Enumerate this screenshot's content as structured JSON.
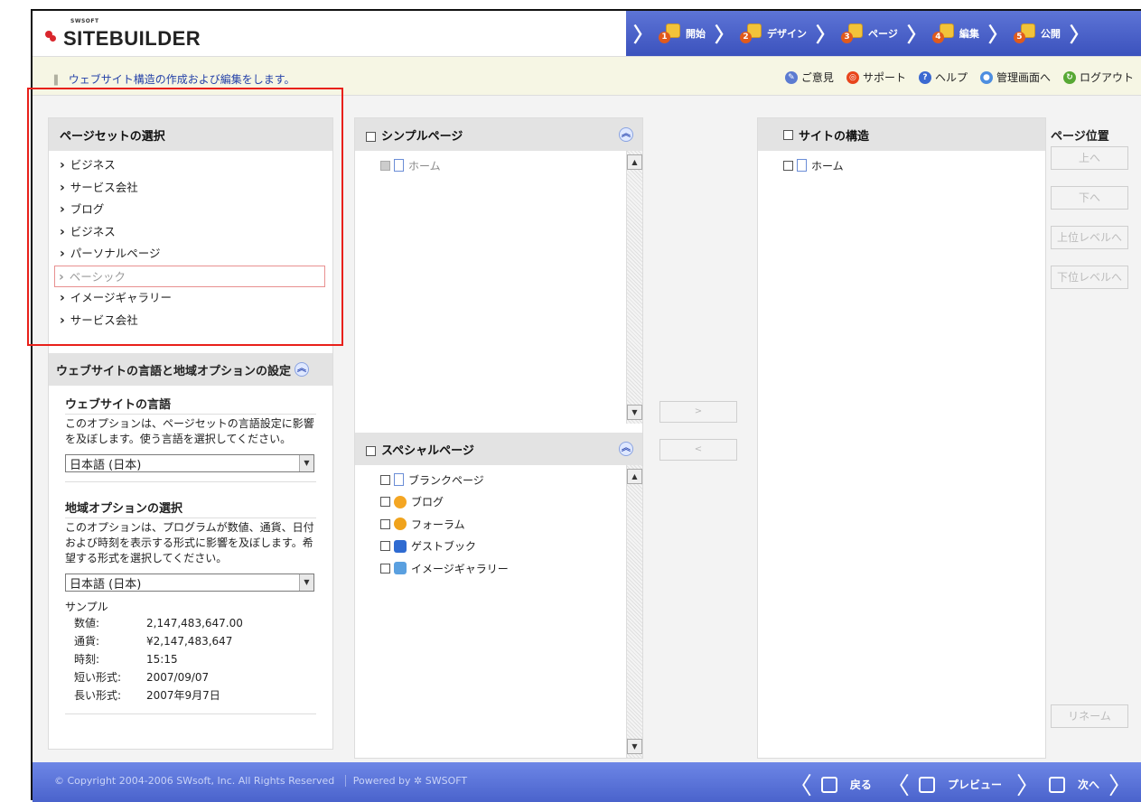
{
  "app": {
    "logo_small": "SWSOFT",
    "logo": "SITEBUILDER",
    "tagline": "ウェブサイト構造の作成および編集をします。"
  },
  "steps": [
    {
      "num": "1",
      "label": "開始"
    },
    {
      "num": "2",
      "label": "デザイン"
    },
    {
      "num": "3",
      "label": "ページ"
    },
    {
      "num": "4",
      "label": "編集"
    },
    {
      "num": "5",
      "label": "公開"
    }
  ],
  "toplinks": [
    {
      "label": "ご意見",
      "color": "#5b7bd1",
      "glyph": "✎"
    },
    {
      "label": "サポート",
      "color": "#e8451c",
      "glyph": "◎"
    },
    {
      "label": "ヘルプ",
      "color": "#3b69d1",
      "glyph": "?"
    },
    {
      "label": "管理画面へ",
      "color": "#4d8ee0",
      "glyph": "●"
    },
    {
      "label": "ログアウト",
      "color": "#57a834",
      "glyph": "↻"
    }
  ],
  "pageset": {
    "title": "ページセットの選択",
    "items": [
      "ビジネス",
      "サービス会社",
      "ブログ",
      "ビジネス",
      "パーソナルページ",
      "ベーシック",
      "イメージギャラリー",
      "サービス会社"
    ],
    "selected_index": 5
  },
  "lang": {
    "title": "ウェブサイトの言語と地域オプションの設定",
    "site_lang_title": "ウェブサイトの言語",
    "site_lang_desc": "このオプションは、ページセットの言語設定に影響を及ぼします。使う言語を選択してください。",
    "site_lang_value": "日本語 (日本)",
    "region_title": "地域オプションの選択",
    "region_desc": "このオプションは、プログラムが数値、通貨、日付および時刻を表示する形式に影響を及ぼします。希望する形式を選択してください。",
    "region_value": "日本語 (日本)",
    "sample_title": "サンプル",
    "samples": [
      {
        "k": "数値:",
        "v": "2,147,483,647.00"
      },
      {
        "k": "通貨:",
        "v": "¥2,147,483,647"
      },
      {
        "k": "時刻:",
        "v": "15:15"
      },
      {
        "k": "短い形式:",
        "v": "2007/09/07"
      },
      {
        "k": "長い形式:",
        "v": "2007年9月7日"
      }
    ]
  },
  "simple": {
    "title": "シンプルページ",
    "items": [
      "ホーム"
    ]
  },
  "special": {
    "title": "スペシャルページ",
    "items": [
      {
        "label": "ブランクページ",
        "icon": "page-icon"
      },
      {
        "label": "ブログ",
        "icon": "blog-icon"
      },
      {
        "label": "フォーラム",
        "icon": "forum-icon"
      },
      {
        "label": "ゲストブック",
        "icon": "guestbook-icon"
      },
      {
        "label": "イメージギャラリー",
        "icon": "gallery-icon"
      }
    ]
  },
  "move": {
    "add": ">",
    "remove": "<"
  },
  "structure": {
    "title": "サイトの構造",
    "items": [
      "ホーム"
    ]
  },
  "position": {
    "title": "ページ位置",
    "up": "上へ",
    "down": "下へ",
    "level_up": "上位レベルへ",
    "level_down": "下位レベルへ",
    "rename": "リネーム"
  },
  "footer": {
    "copyright": "© Copyright 2004-2006 SWsoft, Inc. All Rights Reserved",
    "powered": "Powered by ✲ SWSOFT",
    "back": "戻る",
    "preview": "プレビュー",
    "next": "次へ"
  }
}
